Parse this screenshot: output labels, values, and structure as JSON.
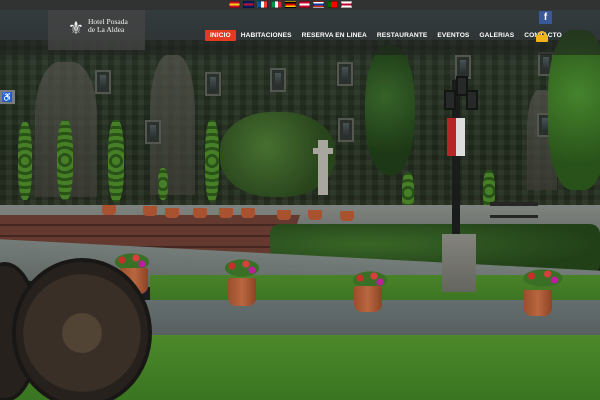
{
  "site": {
    "logo_text": "Hotel Posada\nde La Aldea",
    "logo_icon": "hotel-emblem-icon"
  },
  "languages": [
    {
      "name": "es",
      "colors": [
        "#c8102e",
        "#f7d117",
        "#c8102e"
      ]
    },
    {
      "name": "en",
      "colors": [
        "#012169",
        "#c8102e",
        "#012169"
      ]
    },
    {
      "name": "fr",
      "colors": [
        "#0055a4",
        "#ffffff",
        "#ef4135"
      ],
      "vertical": true
    },
    {
      "name": "it",
      "colors": [
        "#009246",
        "#ffffff",
        "#ce2b37"
      ],
      "vertical": true
    },
    {
      "name": "de",
      "colors": [
        "#000000",
        "#dd0000",
        "#ffce00"
      ]
    },
    {
      "name": "dk",
      "colors": [
        "#c60c30",
        "#ffffff",
        "#c60c30"
      ]
    },
    {
      "name": "ru",
      "colors": [
        "#ffffff",
        "#0039a6",
        "#d52b1e"
      ]
    },
    {
      "name": "pt",
      "colors": [
        "#006600",
        "#ff0000",
        "#ff0000"
      ],
      "vertical": true
    },
    {
      "name": "jp",
      "colors": [
        "#ffffff",
        "#bc002d",
        "#ffffff"
      ]
    }
  ],
  "nav": {
    "items": [
      {
        "label": "INICIO",
        "active": true
      },
      {
        "label": "HABITACIONES",
        "active": false
      },
      {
        "label": "RESERVA EN LINEA",
        "active": false
      },
      {
        "label": "RESTAURANTE",
        "active": false
      },
      {
        "label": "EVENTOS",
        "active": false
      },
      {
        "label": "GALERIAS",
        "active": false
      },
      {
        "label": "CONTACTO",
        "active": false
      }
    ]
  },
  "social": {
    "facebook_label": "f"
  },
  "accessibility": {
    "label": "♿"
  },
  "colors": {
    "accent": "#e43a22",
    "lock": "#f2b31c",
    "facebook": "#3b5998"
  }
}
